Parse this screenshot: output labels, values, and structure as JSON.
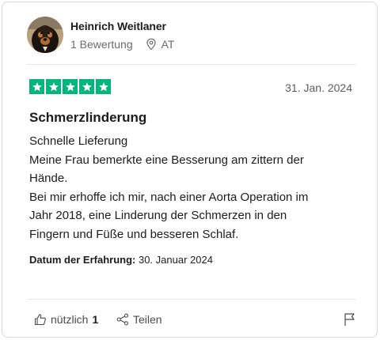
{
  "reviewer": {
    "name": "Heinrich Weitlaner",
    "review_count": "1 Bewertung",
    "country": "AT"
  },
  "review": {
    "rating": 5,
    "rating_max": 5,
    "star_color": "#00b67a",
    "date": "31. Jan. 2024",
    "title": "Schmerzlinderung",
    "body_lines": [
      "Schnelle Lieferung",
      "Meine Frau bemerkte eine Besserung am zittern der",
      "Hände.",
      "Bei mir erhoffe ich mir, nach einer Aorta Operation im",
      "Jahr 2018, eine Linderung der Schmerzen in den",
      "Fingern und Füße und besseren Schlaf."
    ],
    "experience_label": "Datum der Erfahrung:",
    "experience_date": "30. Januar 2024"
  },
  "actions": {
    "useful_label": "nützlich",
    "useful_count": "1",
    "share_label": "Teilen",
    "icons": [
      "thumbs-up-icon",
      "share-icon",
      "flag-icon",
      "location-pin-icon"
    ]
  }
}
